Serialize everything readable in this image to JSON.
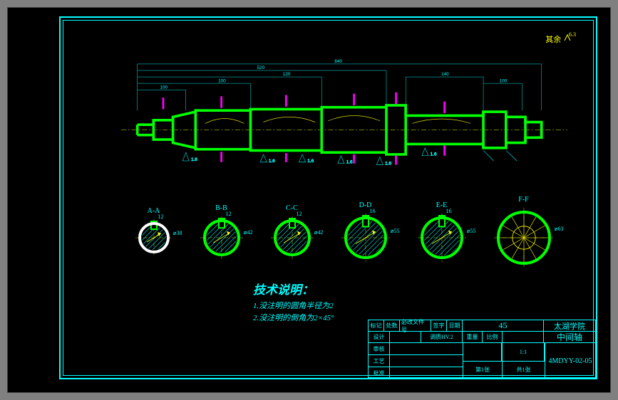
{
  "top_note": {
    "label": "其余",
    "value": "6.3"
  },
  "main_dims": {
    "top_overall": [
      "100",
      "520",
      "840",
      "140",
      "100"
    ],
    "top_inner": [
      "100",
      "100",
      "100",
      "120",
      "120"
    ],
    "dia_labels": [
      "1.6",
      "1.6",
      "1.6",
      "1.6",
      "1.6",
      "1.6"
    ]
  },
  "sections": [
    {
      "label": "A-A",
      "dia": "38",
      "key": "12",
      "ring_color": "#fff",
      "fill": "hatch",
      "size": 40
    },
    {
      "label": "B-B",
      "dia": "42",
      "key": "12",
      "ring_color": "#00ff00",
      "fill": "hatch",
      "size": 48
    },
    {
      "label": "C-C",
      "dia": "42",
      "key": "12",
      "ring_color": "#00ff00",
      "fill": "hatch",
      "size": 48
    },
    {
      "label": "D-D",
      "dia": "55",
      "key": "16",
      "ring_color": "#00ff00",
      "fill": "hatch",
      "size": 56
    },
    {
      "label": "E-E",
      "dia": "55",
      "key": "16",
      "ring_color": "#00ff00",
      "fill": "hatch",
      "size": 56
    },
    {
      "label": "F-F",
      "dia": "63",
      "key": "",
      "ring_color": "#00ff00",
      "fill": "spline",
      "size": 72
    }
  ],
  "tech": {
    "title": "技术说明：",
    "lines": [
      "1.没注明的圆角半径为2",
      "2.没注明的倒角为2×45°"
    ]
  },
  "title_block": {
    "material": "45",
    "school": "太湖学院",
    "part": "中间轴",
    "dwg_no": "4MDYY-02-05",
    "scale": "1:1",
    "mass_label": "重量",
    "scale_label": "比例",
    "treat": "调质HV.2",
    "sheet": "第1张",
    "total": "共1张",
    "hdr": [
      "标记",
      "处数",
      "必改文件号",
      "签字",
      "日期"
    ],
    "roles": [
      "设计",
      "审核",
      "工艺",
      "批准"
    ]
  }
}
